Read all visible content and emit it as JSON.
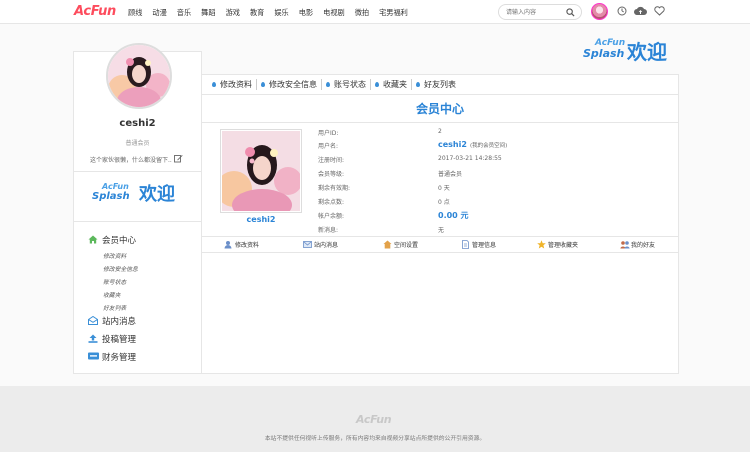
{
  "topbar": {
    "logo": "AcFun",
    "nav": [
      "顾线",
      "动漫",
      "音乐",
      "舞蹈",
      "游戏",
      "教育",
      "娱乐",
      "电影",
      "电视剧",
      "微拍",
      "宅男福利"
    ],
    "search_placeholder": "请输入内容"
  },
  "banner": {
    "line1": "AcFun",
    "line2": "Splash",
    "line3": "欢迎"
  },
  "sidebar": {
    "username": "ceshi2",
    "level": "普通会员",
    "signature": "这个家伙很懒，什么都没留下..",
    "menu": [
      {
        "label": "会员中心",
        "icon": "home-icon",
        "color": "#5cb85c"
      },
      {
        "label": "站内消息",
        "icon": "mail-icon",
        "color": "#3a8fd7"
      },
      {
        "label": "投稿管理",
        "icon": "upload-icon",
        "color": "#3a8fd7"
      },
      {
        "label": "财务管理",
        "icon": "visa-icon",
        "color": "#3a8fd7"
      }
    ],
    "submenu": [
      "修改资料",
      "修改安全信息",
      "账号状态",
      "收藏夹",
      "好友列表"
    ]
  },
  "tabs": [
    "修改资料",
    "修改安全信息",
    "账号状态",
    "收藏夹",
    "好友列表"
  ],
  "content": {
    "title": "会员中心",
    "photo_name": "ceshi2",
    "info": [
      {
        "label": "用户ID:",
        "value": "2"
      },
      {
        "label": "用户名:",
        "value": "ceshi2",
        "note": "(我的会员空间)"
      },
      {
        "label": "注册时间:",
        "value": "2017-03-21 14:28:55"
      },
      {
        "label": "会员等级:",
        "value": "普通会员"
      },
      {
        "label": "剩余有效期:",
        "value": "0 天"
      },
      {
        "label": "剩余点数:",
        "value": "0 点"
      },
      {
        "label": "帐户余额:",
        "value": "0.00 元"
      },
      {
        "label": "新消息:",
        "value": "无"
      }
    ],
    "actions": [
      {
        "label": "修改资料",
        "icon": "user-edit-icon"
      },
      {
        "label": "站内消息",
        "icon": "message-icon"
      },
      {
        "label": "空间设置",
        "icon": "home-settings-icon"
      },
      {
        "label": "管理信息",
        "icon": "document-icon"
      },
      {
        "label": "管理收藏夹",
        "icon": "star-icon"
      },
      {
        "label": "我的好友",
        "icon": "friends-icon"
      }
    ]
  },
  "footer": {
    "logo": "AcFun",
    "text": "本站不提供任何视听上传服务，所有内容均来自视频分享站点所提供的公开引用资源。"
  }
}
